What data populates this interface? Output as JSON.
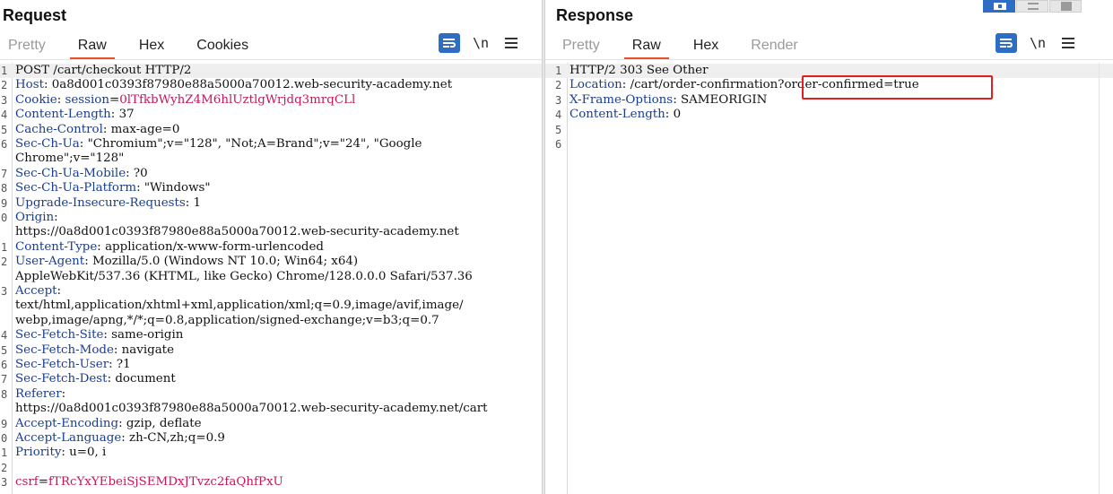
{
  "request": {
    "title": "Request",
    "tabs": [
      "Pretty",
      "Raw",
      "Hex",
      "Cookies"
    ],
    "active_tab": "Raw",
    "newline_label": "\\n",
    "lines": [
      {
        "n": "1",
        "parts": [
          {
            "t": "POST /cart/checkout HTTP/2",
            "c": ""
          }
        ]
      },
      {
        "n": "2",
        "parts": [
          {
            "t": "Host",
            "c": "hk"
          },
          {
            "t": ": 0a8d001c0393f87980e88a5000a70012.web-security-academy.net",
            "c": ""
          }
        ]
      },
      {
        "n": "3",
        "parts": [
          {
            "t": "Cookie",
            "c": "hk"
          },
          {
            "t": ": ",
            "c": ""
          },
          {
            "t": "session",
            "c": "hk"
          },
          {
            "t": "=",
            "c": ""
          },
          {
            "t": "0lTfkbWyhZ4M6hlUztlgWrjdq3mrqCLl",
            "c": "cv"
          }
        ]
      },
      {
        "n": "4",
        "parts": [
          {
            "t": "Content-Length",
            "c": "hk"
          },
          {
            "t": ": 37",
            "c": ""
          }
        ]
      },
      {
        "n": "5",
        "parts": [
          {
            "t": "Cache-Control",
            "c": "hk"
          },
          {
            "t": ": max-age=0",
            "c": ""
          }
        ]
      },
      {
        "n": "6",
        "parts": [
          {
            "t": "Sec-Ch-Ua",
            "c": "hk"
          },
          {
            "t": ": \"Chromium\";v=\"128\", \"Not;A=Brand\";v=\"24\", \"Google",
            "c": ""
          }
        ]
      },
      {
        "n": "",
        "parts": [
          {
            "t": "Chrome\";v=\"128\"",
            "c": ""
          }
        ]
      },
      {
        "n": "7",
        "parts": [
          {
            "t": "Sec-Ch-Ua-Mobile",
            "c": "hk"
          },
          {
            "t": ": ?0",
            "c": ""
          }
        ]
      },
      {
        "n": "8",
        "parts": [
          {
            "t": "Sec-Ch-Ua-Platform",
            "c": "hk"
          },
          {
            "t": ": \"Windows\"",
            "c": ""
          }
        ]
      },
      {
        "n": "9",
        "parts": [
          {
            "t": "Upgrade-Insecure-Requests",
            "c": "hk"
          },
          {
            "t": ": 1",
            "c": ""
          }
        ]
      },
      {
        "n": "0",
        "parts": [
          {
            "t": "Origin",
            "c": "hk"
          },
          {
            "t": ":",
            "c": ""
          }
        ]
      },
      {
        "n": "",
        "parts": [
          {
            "t": "https://0a8d001c0393f87980e88a5000a70012.web-security-academy.net",
            "c": ""
          }
        ]
      },
      {
        "n": "1",
        "parts": [
          {
            "t": "Content-Type",
            "c": "hk"
          },
          {
            "t": ": application/x-www-form-urlencoded",
            "c": ""
          }
        ]
      },
      {
        "n": "2",
        "parts": [
          {
            "t": "User-Agent",
            "c": "hk"
          },
          {
            "t": ": Mozilla/5.0 (Windows NT 10.0; Win64; x64)",
            "c": ""
          }
        ]
      },
      {
        "n": "",
        "parts": [
          {
            "t": "AppleWebKit/537.36 (KHTML, like Gecko) Chrome/128.0.0.0 Safari/537.36",
            "c": ""
          }
        ]
      },
      {
        "n": "3",
        "parts": [
          {
            "t": "Accept",
            "c": "hk"
          },
          {
            "t": ":",
            "c": ""
          }
        ]
      },
      {
        "n": "",
        "parts": [
          {
            "t": "text/html,application/xhtml+xml,application/xml;q=0.9,image/avif,image/",
            "c": ""
          }
        ]
      },
      {
        "n": "",
        "parts": [
          {
            "t": "webp,image/apng,*/*;q=0.8,application/signed-exchange;v=b3;q=0.7",
            "c": ""
          }
        ]
      },
      {
        "n": "4",
        "parts": [
          {
            "t": "Sec-Fetch-Site",
            "c": "hk"
          },
          {
            "t": ": same-origin",
            "c": ""
          }
        ]
      },
      {
        "n": "5",
        "parts": [
          {
            "t": "Sec-Fetch-Mode",
            "c": "hk"
          },
          {
            "t": ": navigate",
            "c": ""
          }
        ]
      },
      {
        "n": "6",
        "parts": [
          {
            "t": "Sec-Fetch-User",
            "c": "hk"
          },
          {
            "t": ": ?1",
            "c": ""
          }
        ]
      },
      {
        "n": "7",
        "parts": [
          {
            "t": "Sec-Fetch-Dest",
            "c": "hk"
          },
          {
            "t": ": document",
            "c": ""
          }
        ]
      },
      {
        "n": "8",
        "parts": [
          {
            "t": "Referer",
            "c": "hk"
          },
          {
            "t": ":",
            "c": ""
          }
        ]
      },
      {
        "n": "",
        "parts": [
          {
            "t": "https://0a8d001c0393f87980e88a5000a70012.web-security-academy.net/cart",
            "c": ""
          }
        ]
      },
      {
        "n": "9",
        "parts": [
          {
            "t": "Accept-Encoding",
            "c": "hk"
          },
          {
            "t": ": gzip, deflate",
            "c": ""
          }
        ]
      },
      {
        "n": "0",
        "parts": [
          {
            "t": "Accept-Language",
            "c": "hk"
          },
          {
            "t": ": zh-CN,zh;q=0.9",
            "c": ""
          }
        ]
      },
      {
        "n": "1",
        "parts": [
          {
            "t": "Priority",
            "c": "hk"
          },
          {
            "t": ": u=0, i",
            "c": ""
          }
        ]
      },
      {
        "n": "2",
        "parts": [
          {
            "t": "",
            "c": ""
          }
        ]
      },
      {
        "n": "3",
        "parts": [
          {
            "t": "csrf",
            "c": "ck"
          },
          {
            "t": "=",
            "c": ""
          },
          {
            "t": "fTRcYxYEbeiSjSEMDxJTvzc2faQhfPxU",
            "c": "cv"
          }
        ]
      }
    ]
  },
  "response": {
    "title": "Response",
    "tabs": [
      "Pretty",
      "Raw",
      "Hex",
      "Render"
    ],
    "active_tab": "Raw",
    "newline_label": "\\n",
    "lines": [
      {
        "n": "1",
        "parts": [
          {
            "t": "HTTP/2 303 See Other",
            "c": ""
          }
        ]
      },
      {
        "n": "2",
        "parts": [
          {
            "t": "Location",
            "c": "hk"
          },
          {
            "t": ": /cart/order-confirmation?order-confirmed=true",
            "c": ""
          }
        ]
      },
      {
        "n": "3",
        "parts": [
          {
            "t": "X-Frame-Options",
            "c": "hk"
          },
          {
            "t": ": SAMEORIGIN",
            "c": ""
          }
        ]
      },
      {
        "n": "4",
        "parts": [
          {
            "t": "Content-Length",
            "c": "hk"
          },
          {
            "t": ": 0",
            "c": ""
          }
        ]
      },
      {
        "n": "5",
        "parts": [
          {
            "t": "",
            "c": ""
          }
        ]
      },
      {
        "n": "6",
        "parts": [
          {
            "t": "",
            "c": ""
          }
        ]
      }
    ]
  },
  "colors": {
    "accent": "#e8512c",
    "header_key": "#1a3d8f",
    "value_highlight": "#c2185b",
    "annotation_box": "#e02020",
    "button_blue": "#2e6dc3"
  },
  "icons": [
    "word-wrap-icon",
    "hamburger-menu-icon",
    "layout-split-icon",
    "layout-horizontal-icon",
    "layout-single-icon"
  ]
}
